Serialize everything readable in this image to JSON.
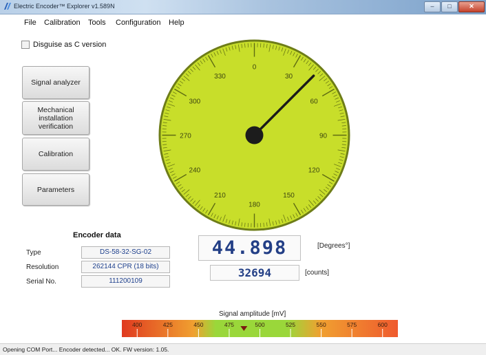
{
  "window": {
    "title": "Electric Encoder™ Explorer v1.589N",
    "minimize": "–",
    "maximize": "□",
    "close": "✕"
  },
  "menu": [
    "File",
    "Calibration",
    "Tools",
    "Configuration",
    "Help"
  ],
  "disguise": {
    "label": "Disguise as  C version",
    "checked": false
  },
  "nav_buttons": [
    {
      "label": "Signal analyzer"
    },
    {
      "label": "Mechanical\ninstallation\nverification"
    },
    {
      "label": "Calibration"
    },
    {
      "label": "Parameters"
    }
  ],
  "gauge": {
    "labels": [
      "0",
      "30",
      "60",
      "90",
      "120",
      "150",
      "180",
      "210",
      "240",
      "270",
      "300",
      "330"
    ],
    "needle_deg": 44.898,
    "face_color": "#c8de2a"
  },
  "encoder_data": {
    "title": "Encoder data",
    "rows": [
      {
        "label": "Type",
        "value": "DS-58-32-SG-02"
      },
      {
        "label": "Resolution",
        "value": "262144 CPR (18 bits)"
      },
      {
        "label": "Serial No.",
        "value": "111200109"
      }
    ]
  },
  "readout": {
    "degrees": "44.898",
    "degrees_unit": "[Degrees°]",
    "counts": "32694",
    "counts_unit": "[counts]"
  },
  "signal_amplitude": {
    "label": "Signal amplitude [mV]",
    "ticks": [
      "400",
      "425",
      "450",
      "475",
      "500",
      "525",
      "550",
      "575",
      "600"
    ],
    "marker_value": 487,
    "range": [
      387.5,
      612.5
    ],
    "colors": {
      "low": "#e03a20",
      "mid": "#9ad73a",
      "high": "#ef5a2e"
    }
  },
  "status": "Opening COM Port... Encoder detected... OK. FW version: 1.05."
}
